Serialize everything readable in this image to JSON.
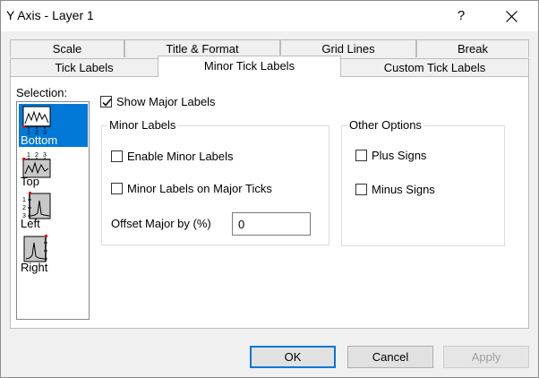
{
  "window": {
    "title": "Y Axis - Layer 1",
    "help_label": "?"
  },
  "tabs_row_back": [
    {
      "label": "Scale"
    },
    {
      "label": "Title & Format"
    },
    {
      "label": "Grid Lines"
    },
    {
      "label": "Break"
    }
  ],
  "tabs_row_front": [
    {
      "label": "Tick Labels"
    },
    {
      "label": "Minor Tick Labels",
      "active": true
    },
    {
      "label": "Custom Tick Labels"
    }
  ],
  "selection": {
    "label": "Selection:",
    "items": [
      {
        "label": "Bottom",
        "selected": true,
        "icon": "axis-bottom-icon"
      },
      {
        "label": "Top",
        "icon": "axis-top-icon"
      },
      {
        "label": "Left",
        "icon": "axis-left-icon"
      },
      {
        "label": "Right",
        "icon": "axis-right-icon"
      }
    ],
    "icon_tick_digits": [
      "1",
      "2",
      "3"
    ]
  },
  "show_major_labels": {
    "label": "Show Major Labels",
    "checked": true
  },
  "minor_labels": {
    "title": "Minor Labels",
    "enable_minor": {
      "label": "Enable Minor Labels",
      "checked": false
    },
    "minor_on_major": {
      "label": "Minor Labels on Major Ticks",
      "checked": false
    },
    "offset_label": "Offset Major by (%)",
    "offset_value": "0"
  },
  "other_options": {
    "title": "Other Options",
    "plus_signs": {
      "label": "Plus Signs",
      "checked": false
    },
    "minus_signs": {
      "label": "Minus Signs",
      "checked": false
    }
  },
  "buttons": {
    "ok": "OK",
    "cancel": "Cancel",
    "apply": "Apply"
  },
  "colors": {
    "accent": "#0078d7",
    "marker": "#e81123"
  }
}
